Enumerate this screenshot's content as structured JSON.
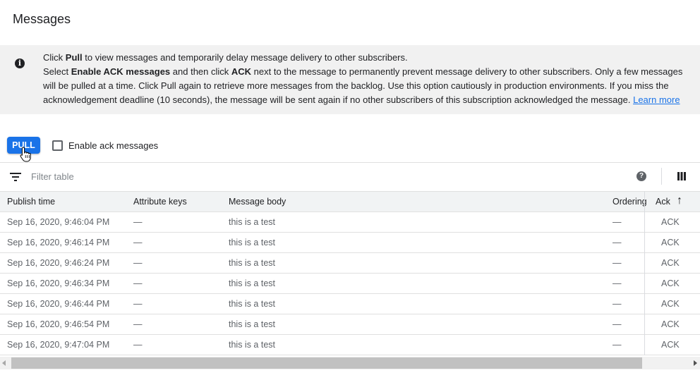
{
  "page_title": "Messages",
  "info": {
    "icon": "info-icon",
    "line1_a": "Click ",
    "line1_b": "Pull",
    "line1_c": " to view messages and temporarily delay message delivery to other subscribers.",
    "line2_a": "Select ",
    "line2_b": "Enable ACK messages",
    "line2_c": " and then click ",
    "line2_d": "ACK",
    "line2_e": " next to the message to permanently prevent message delivery to other subscribers. Only a few messages will be pulled at a time. Click Pull again to retrieve more messages from the backlog. Use this option cautiously in production environments. If you miss the acknowledgement deadline (10 seconds), the message will be sent again if no other subscribers of this subscription acknowledged the message. ",
    "learn_more": "Learn more"
  },
  "toolbar": {
    "pull_label": "PULL",
    "enable_ack_label": "Enable ack messages",
    "enable_ack_checked": false
  },
  "filter": {
    "placeholder": "Filter table",
    "help_symbol": "?"
  },
  "table": {
    "headers": {
      "publish_time": "Publish time",
      "attribute_keys": "Attribute keys",
      "message_body": "Message body",
      "ordering": "Ordering",
      "ack": "Ack",
      "ack_sort": "↑"
    },
    "rows": [
      {
        "publish_time": "Sep 16, 2020, 9:46:04 PM",
        "attribute_keys": "—",
        "message_body": "this is a test",
        "ordering": "—",
        "ack": "ACK"
      },
      {
        "publish_time": "Sep 16, 2020, 9:46:14 PM",
        "attribute_keys": "—",
        "message_body": "this is a test",
        "ordering": "—",
        "ack": "ACK"
      },
      {
        "publish_time": "Sep 16, 2020, 9:46:24 PM",
        "attribute_keys": "—",
        "message_body": "this is a test",
        "ordering": "—",
        "ack": "ACK"
      },
      {
        "publish_time": "Sep 16, 2020, 9:46:34 PM",
        "attribute_keys": "—",
        "message_body": "this is a test",
        "ordering": "—",
        "ack": "ACK"
      },
      {
        "publish_time": "Sep 16, 2020, 9:46:44 PM",
        "attribute_keys": "—",
        "message_body": "this is a test",
        "ordering": "—",
        "ack": "ACK"
      },
      {
        "publish_time": "Sep 16, 2020, 9:46:54 PM",
        "attribute_keys": "—",
        "message_body": "this is a test",
        "ordering": "—",
        "ack": "ACK"
      },
      {
        "publish_time": "Sep 16, 2020, 9:47:04 PM",
        "attribute_keys": "—",
        "message_body": "this is a test",
        "ordering": "—",
        "ack": "ACK"
      }
    ]
  },
  "colors": {
    "accent": "#1a73e8",
    "info_bg": "#f1f1f1",
    "header_bg": "#f1f3f4"
  }
}
